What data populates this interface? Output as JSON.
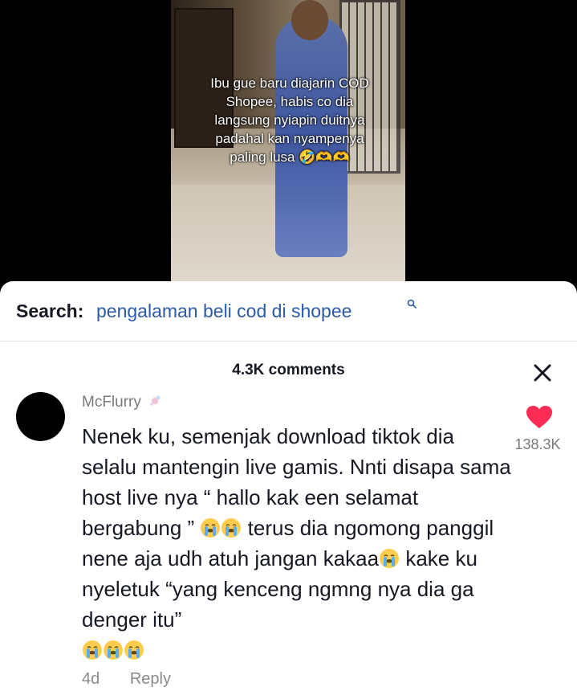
{
  "video": {
    "caption": "Ibu gue baru diajarin COD Shopee, habis co dia langsung nyiapin duitnya padahal kan nyampenya paling lusa 🤣🫶🫶"
  },
  "search": {
    "label": "Search:",
    "term": "pengalaman beli cod di shopee",
    "icon": "search-icon"
  },
  "comments_header": {
    "count_text": "4.3K comments",
    "close_icon": "close-icon"
  },
  "comment": {
    "username": "McFlurry",
    "text_part1": "Nenek ku, semenjak download tiktok dia selalu mantengin live gamis. Nnti disapa sama host live nya “ hallo kak een selamat bergabung ” ",
    "text_part2": " terus dia ngomong panggil nene aja udh atuh jangan kakaa",
    "text_part3": " kake ku nyeletuk “yang kenceng ngmng nya dia ga denger itu”",
    "emoji": "loudly-crying-face",
    "age": "4d",
    "reply_label": "Reply",
    "like_count": "138.3K",
    "like_color": "#fe2c55"
  }
}
